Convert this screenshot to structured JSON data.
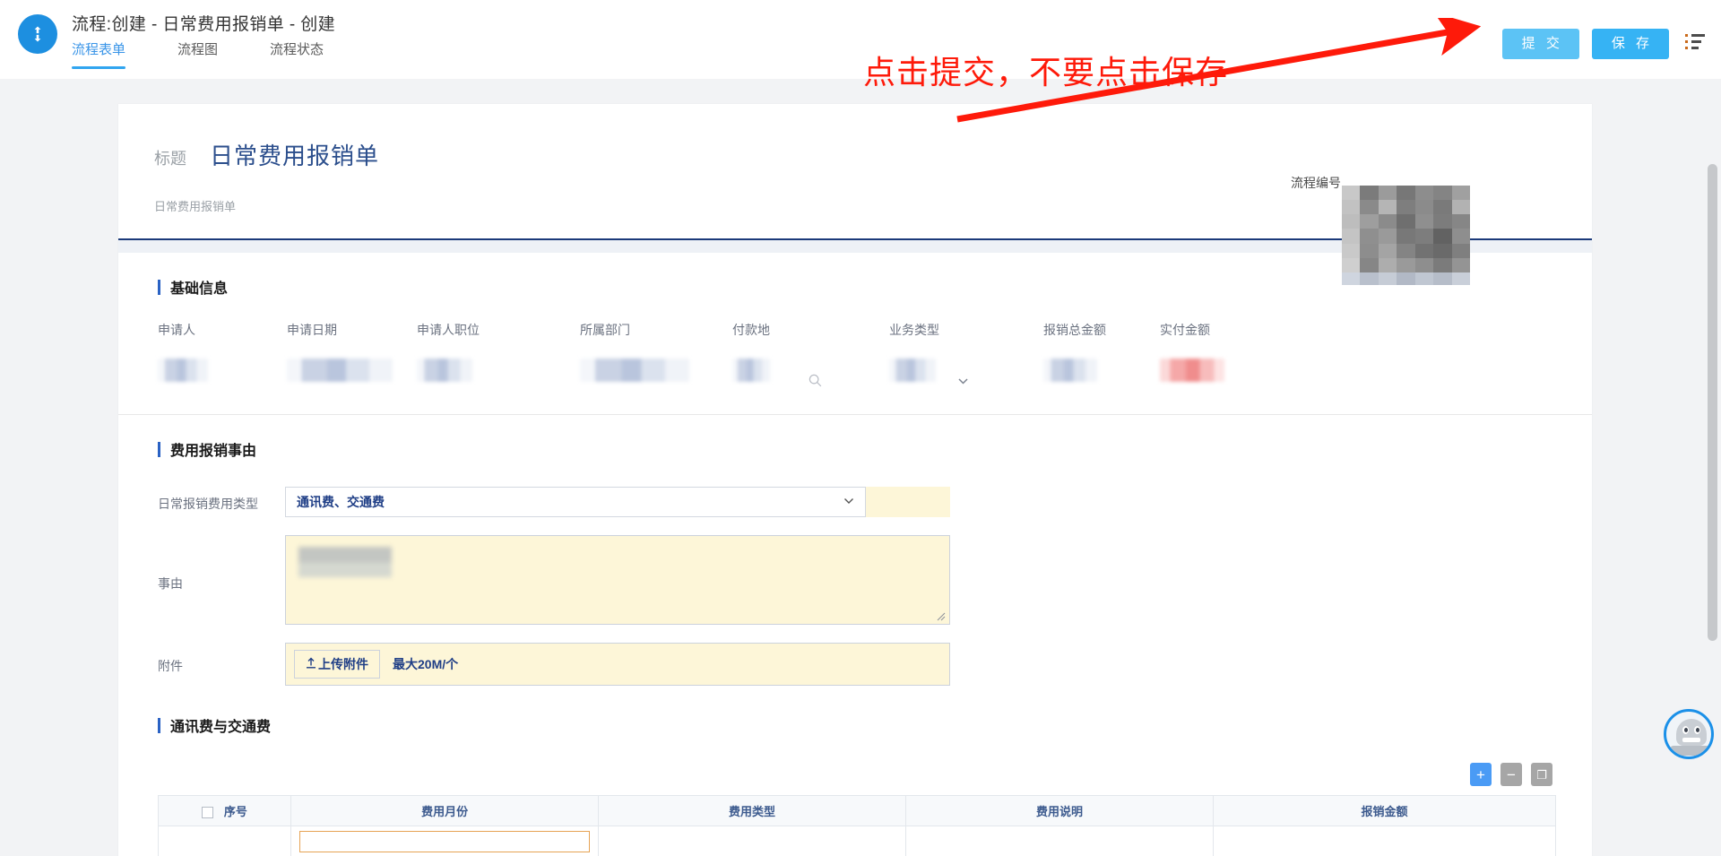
{
  "topbar": {
    "logo_icon": "process-refresh-icon",
    "title": "流程:创建 - 日常费用报销单 - 创建",
    "tabs": [
      {
        "label": "流程表单",
        "active": true
      },
      {
        "label": "流程图",
        "active": false
      },
      {
        "label": "流程状态",
        "active": false
      }
    ],
    "submit_label": "提 交",
    "save_label": "保 存",
    "menu_icon": "list-menu-icon",
    "accent_color": "#36b3f4",
    "submit_color": "#5cc3f5"
  },
  "annotation": {
    "text": "点击提交，不要点击保存",
    "color": "#fe1a0a",
    "arrow_icon": "red-arrow-icon"
  },
  "form_header": {
    "title_label": "标题",
    "title_value": "日常费用报销单",
    "subtitle": "日常费用报销单",
    "process_no_label": "流程编号",
    "title_color": "#2b4e8c"
  },
  "basic_section": {
    "heading": "基础信息",
    "fields": [
      {
        "label": "申请人",
        "value": "",
        "redacted": true,
        "icon": ""
      },
      {
        "label": "申请日期",
        "value": "",
        "redacted": true,
        "icon": ""
      },
      {
        "label": "申请人职位",
        "value": "",
        "redacted": true,
        "icon": ""
      },
      {
        "label": "所属部门",
        "value": "",
        "redacted": true,
        "icon": ""
      },
      {
        "label": "付款地",
        "value": "",
        "redacted": true,
        "icon": "search-icon"
      },
      {
        "label": "业务类型",
        "value": "",
        "redacted": true,
        "icon": "chevron-down-icon"
      },
      {
        "label": "报销总金额",
        "value": "",
        "redacted": true,
        "icon": ""
      },
      {
        "label": "实付金额",
        "value": "",
        "redacted": true,
        "icon": ""
      }
    ]
  },
  "reason_section": {
    "heading": "费用报销事由",
    "expense_type_label": "日常报销费用类型",
    "expense_type_value": "通讯费、交通费",
    "reason_label": "事由",
    "reason_value": "",
    "attachment_label": "附件",
    "upload_button": "上传附件",
    "upload_icon": "upload-icon",
    "upload_hint": "最大20M/个"
  },
  "table_section": {
    "heading": "通讯费与交通费",
    "tools": [
      {
        "name": "add-row-button",
        "glyph": "+",
        "color": "#4a9bf5"
      },
      {
        "name": "remove-row-button",
        "glyph": "−",
        "color": "#a6a6a6"
      },
      {
        "name": "copy-row-button",
        "glyph": "❐",
        "color": "#a6a6a6"
      }
    ],
    "columns": [
      "序号",
      "费用月份",
      "费用类型",
      "费用说明",
      "报销金额"
    ],
    "rows": [
      {
        "序号": "",
        "费用月份": "",
        "费用类型": "",
        "费用说明": "",
        "报销金额": ""
      }
    ]
  },
  "chatbot": {
    "icon": "robot-assistant-icon"
  },
  "scrollbar": {
    "icon": "vertical-scrollbar"
  }
}
